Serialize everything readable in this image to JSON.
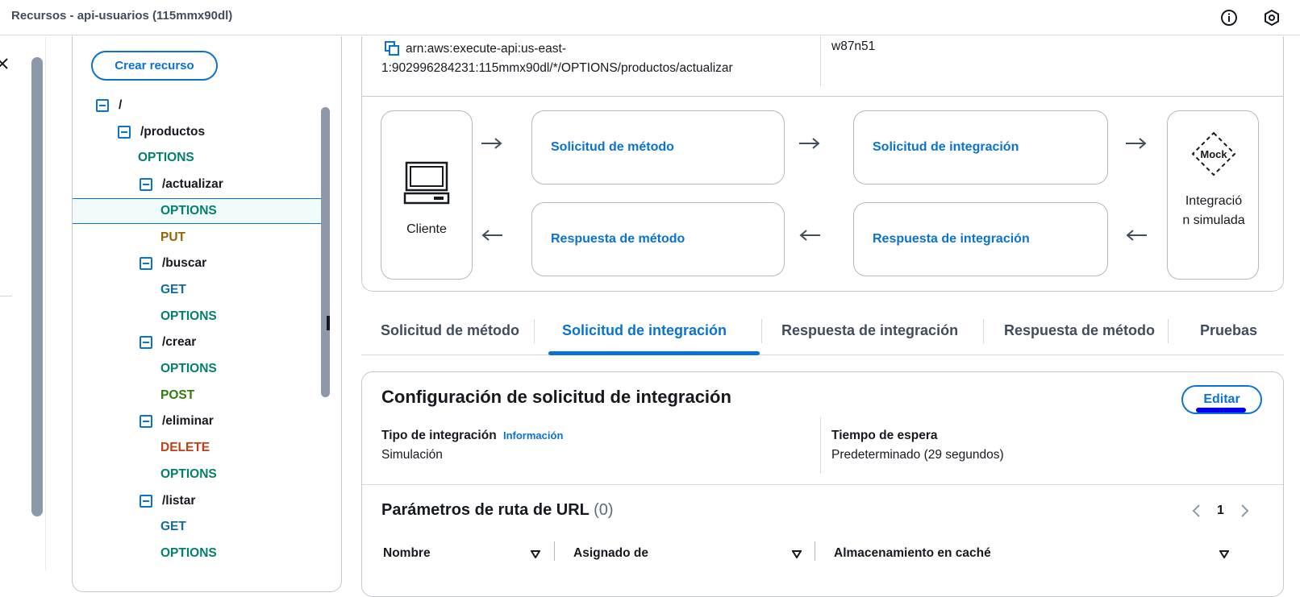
{
  "window": {
    "title": "Recursos - api-usuarios (115mmx90dl)"
  },
  "sidebar": {
    "create_button": "Crear recurso"
  },
  "tree": [
    {
      "label": "/",
      "kind": "resource",
      "has_toggle": true
    },
    {
      "label": "/productos",
      "kind": "resource",
      "has_toggle": true
    },
    {
      "label": "OPTIONS",
      "kind": "options"
    },
    {
      "label": "/actualizar",
      "kind": "resource",
      "has_toggle": true
    },
    {
      "label": "OPTIONS",
      "kind": "options",
      "selected": true
    },
    {
      "label": "PUT",
      "kind": "put"
    },
    {
      "label": "/buscar",
      "kind": "resource",
      "has_toggle": true
    },
    {
      "label": "GET",
      "kind": "get"
    },
    {
      "label": "OPTIONS",
      "kind": "options"
    },
    {
      "label": "/crear",
      "kind": "resource",
      "has_toggle": true
    },
    {
      "label": "OPTIONS",
      "kind": "options"
    },
    {
      "label": "POST",
      "kind": "post"
    },
    {
      "label": "/eliminar",
      "kind": "resource",
      "has_toggle": true
    },
    {
      "label": "DELETE",
      "kind": "delete"
    },
    {
      "label": "OPTIONS",
      "kind": "options"
    },
    {
      "label": "/listar",
      "kind": "resource",
      "has_toggle": true
    },
    {
      "label": "GET",
      "kind": "get"
    },
    {
      "label": "OPTIONS",
      "kind": "options"
    }
  ],
  "arn": {
    "value": "arn:aws:execute-api:us-east-1:902996284231:115mmx90dl/*/OPTIONS/productos/actualizar",
    "resource_id": "w87n51"
  },
  "flow": {
    "client_label": "Cliente",
    "method_request": "Solicitud de método",
    "integration_request": "Solicitud de integración",
    "method_response": "Respuesta de método",
    "integration_response": "Respuesta de integración",
    "mock_label": "Mock",
    "mock_caption": "Integración simulada"
  },
  "tabs": [
    {
      "label": "Solicitud de método",
      "active": false
    },
    {
      "label": "Solicitud de integración",
      "active": true
    },
    {
      "label": "Respuesta de integración",
      "active": false
    },
    {
      "label": "Respuesta de método",
      "active": false
    },
    {
      "label": "Pruebas",
      "active": false
    }
  ],
  "config": {
    "title": "Configuración de solicitud de integración",
    "edit_button": "Editar",
    "integration_type_label": "Tipo de integración",
    "info_link": "Información",
    "integration_type_value": "Simulación",
    "timeout_label": "Tiempo de espera",
    "timeout_value": "Predeterminado (29 segundos)"
  },
  "url_params": {
    "title": "Parámetros de ruta de URL",
    "count": "(0)",
    "page": "1",
    "columns": [
      "Nombre",
      "Asignado de",
      "Almacenamiento en caché"
    ]
  },
  "colors": {
    "accent": "#0972d3",
    "options": "#037f6c",
    "put": "#8d6605",
    "get": "#0f6e9c",
    "post": "#2f7d07",
    "delete": "#c33d18"
  }
}
